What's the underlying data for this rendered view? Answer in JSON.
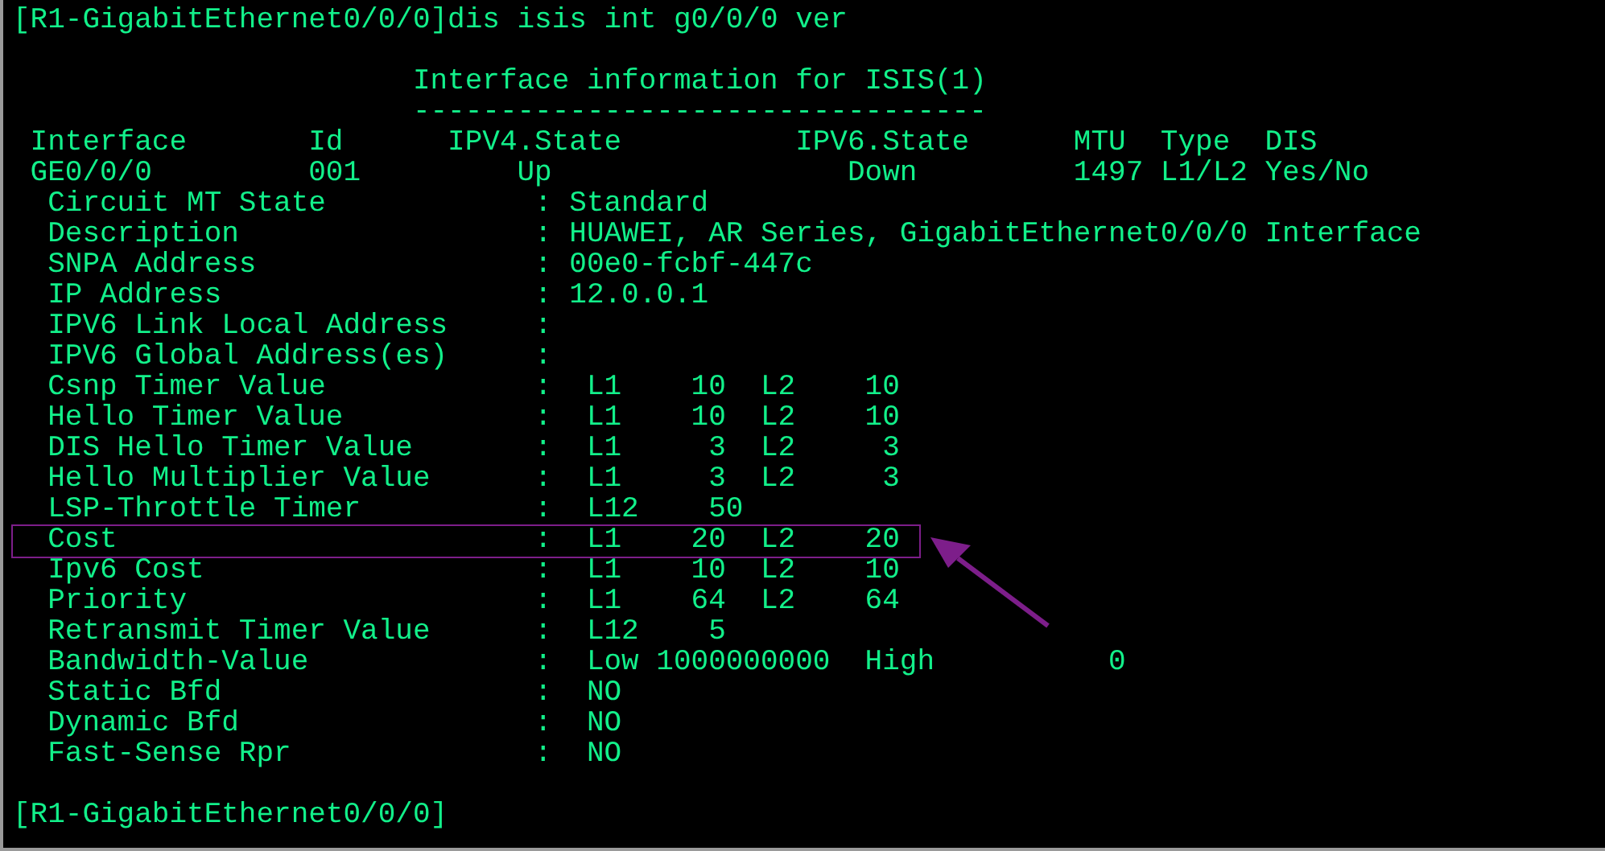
{
  "terminal": {
    "command": "[R1-GigabitEthernet0/0/0]dis isis int g0/0/0 ver",
    "output": [
      {
        "text": "                       Interface information for ISIS(1)",
        "highlighted": false
      },
      {
        "text": "                       ---------------------------------",
        "highlighted": false
      },
      {
        "text": " Interface       Id      IPV4.State          IPV6.State      MTU  Type  DIS",
        "highlighted": false
      },
      {
        "text": " GE0/0/0         001         Up                 Down         1497 L1/L2 Yes/No",
        "highlighted": false
      },
      {
        "text": "  Circuit MT State            : Standard",
        "highlighted": false
      },
      {
        "text": "  Description                 : HUAWEI, AR Series, GigabitEthernet0/0/0 Interface",
        "highlighted": false
      },
      {
        "text": "  SNPA Address                : 00e0-fcbf-447c",
        "highlighted": false
      },
      {
        "text": "  IP Address                  : 12.0.0.1",
        "highlighted": false
      },
      {
        "text": "  IPV6 Link Local Address     :",
        "highlighted": false
      },
      {
        "text": "  IPV6 Global Address(es)     :",
        "highlighted": false
      },
      {
        "text": "  Csnp Timer Value            :  L1    10  L2    10",
        "highlighted": false
      },
      {
        "text": "  Hello Timer Value           :  L1    10  L2    10",
        "highlighted": false
      },
      {
        "text": "  DIS Hello Timer Value       :  L1     3  L2     3",
        "highlighted": false
      },
      {
        "text": "  Hello Multiplier Value      :  L1     3  L2     3",
        "highlighted": false
      },
      {
        "text": "  LSP-Throttle Timer          :  L12    50",
        "highlighted": false
      },
      {
        "text": "  Cost                        :  L1    20  L2    20",
        "highlighted": true
      },
      {
        "text": "  Ipv6 Cost                   :  L1    10  L2    10",
        "highlighted": false
      },
      {
        "text": "  Priority                    :  L1    64  L2    64",
        "highlighted": false
      },
      {
        "text": "  Retransmit Timer Value      :  L12    5",
        "highlighted": false
      },
      {
        "text": "  Bandwidth-Value             :  Low 1000000000  High          0",
        "highlighted": false
      },
      {
        "text": "  Static Bfd                  :  NO",
        "highlighted": false
      },
      {
        "text": "  Dynamic Bfd                 :  NO",
        "highlighted": false
      },
      {
        "text": "  Fast-Sense Rpr              :  NO",
        "highlighted": false
      }
    ],
    "prompt": "[R1-GigabitEthernet0/0/0]"
  }
}
